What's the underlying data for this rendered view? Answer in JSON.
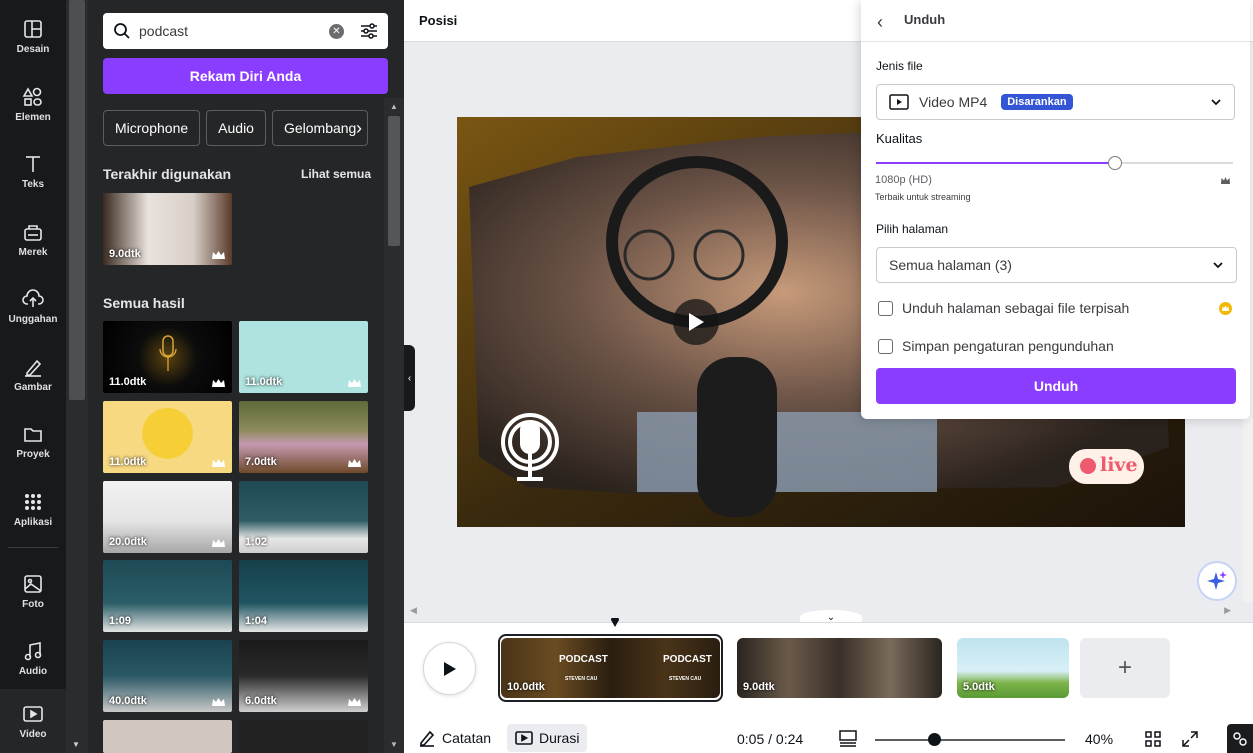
{
  "nav": {
    "items": [
      {
        "label": "Desain",
        "icon": "layout-icon"
      },
      {
        "label": "Elemen",
        "icon": "shapes-icon"
      },
      {
        "label": "Teks",
        "icon": "text-icon"
      },
      {
        "label": "Merek",
        "icon": "brand-icon"
      },
      {
        "label": "Unggahan",
        "icon": "upload-icon"
      },
      {
        "label": "Gambar",
        "icon": "draw-icon"
      },
      {
        "label": "Proyek",
        "icon": "folder-icon"
      },
      {
        "label": "Aplikasi",
        "icon": "apps-icon"
      },
      {
        "label": "Foto",
        "icon": "photo-icon"
      },
      {
        "label": "Audio",
        "icon": "music-icon"
      },
      {
        "label": "Video",
        "icon": "video-icon"
      }
    ],
    "active": "Video"
  },
  "panel": {
    "search_value": "podcast",
    "record_label": "Rekam Diri Anda",
    "chips": [
      "Microphone",
      "Audio",
      "Gelombang"
    ],
    "recent_title": "Terakhir digunakan",
    "see_all": "Lihat semua",
    "recent": [
      {
        "dur": "9.0dtk"
      }
    ],
    "all_title": "Semua hasil",
    "results": [
      {
        "dur": "11.0dtk"
      },
      {
        "dur": "11.0dtk"
      },
      {
        "dur": "11.0dtk"
      },
      {
        "dur": "7.0dtk"
      },
      {
        "dur": "20.0dtk"
      },
      {
        "dur": "1:02"
      },
      {
        "dur": "1:09"
      },
      {
        "dur": "1:04"
      },
      {
        "dur": "40.0dtk"
      },
      {
        "dur": "6.0dtk"
      }
    ]
  },
  "topbar": {
    "title": "Posisi"
  },
  "canvas": {
    "live_text": "live"
  },
  "timeline": {
    "clips": [
      {
        "dur": "10.0dtk",
        "title": "PODCAST",
        "subtitle": "STEVEN CAU"
      },
      {
        "dur": "9.0dtk"
      },
      {
        "dur": "5.0dtk"
      }
    ],
    "add_label": "+"
  },
  "bottombar": {
    "notes": "Catatan",
    "duration": "Durasi",
    "time": "0:05 / 0:24",
    "zoom": "40%",
    "zoom_fraction": 0.31
  },
  "download": {
    "title": "Unduh",
    "file_type_label": "Jenis file",
    "file_type": "Video MP4",
    "badge": "Disarankan",
    "quality_label": "Kualitas",
    "quality_value": "1080p (HD)",
    "quality_sub": "Terbaik untuk streaming",
    "quality_fraction": 0.67,
    "pages_label": "Pilih halaman",
    "pages_value": "Semua halaman (3)",
    "separate_label": "Unduh halaman sebagai file terpisah",
    "save_label": "Simpan pengaturan pengunduhan",
    "button": "Unduh"
  },
  "colors": {
    "accent": "#8b3dff",
    "nav_bg": "#18191b",
    "badge": "#3456d6"
  }
}
